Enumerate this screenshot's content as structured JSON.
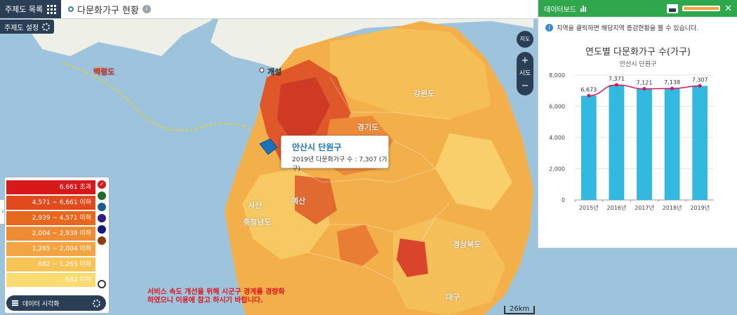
{
  "topbar": {
    "theme_list_label": "주제도 목록",
    "map_title": "다문화가구 현황",
    "info_icon": "info-icon"
  },
  "setting_label": "주제도 설정",
  "zoom": {
    "pin_label": "지도",
    "plus": "+",
    "minus": "−",
    "level_label": "시도"
  },
  "tooltip": {
    "region": "안산시 단원구",
    "detail": "2019년 다문화가구 수 : 7,307 (가구)"
  },
  "places": [
    "백령도",
    "개성",
    "강원도",
    "경기도",
    "충청남도",
    "경상북도",
    "서산",
    "예산",
    "대구"
  ],
  "notice": [
    "서비스 속도 개선을 위해 시군구 경계를 경량화",
    "하였으니 이용에 참고 하시기 바랍니다."
  ],
  "scale_label": "26km",
  "legend": {
    "items": [
      {
        "label": "6,661 초과",
        "color": "#d7191c"
      },
      {
        "label": "4,571 ~ 6,661 이하",
        "color": "#e04a1c"
      },
      {
        "label": "2,939 ~ 4,571 이하",
        "color": "#e8671f"
      },
      {
        "label": "2,004 ~ 2,939 이하",
        "color": "#ee8c33"
      },
      {
        "label": "1,265 ~ 2,004 이하",
        "color": "#f3a544"
      },
      {
        "label": "682 ~ 1,265 이하",
        "color": "#f6c457"
      },
      {
        "label": "682 이하",
        "color": "#f9db70"
      }
    ],
    "swatches": [
      "#d7191c",
      "#1e6b26",
      "#1c5d8c",
      "#2b1d85",
      "#141b7a",
      "#8c3b12"
    ],
    "viz_label": "데이터 시각화"
  },
  "dashboard": {
    "header_label": "데이터보드",
    "info_text": "지역을 클릭하면 해당지역 증감현황을 볼 수 있습니다.",
    "accent": "#2fa74d"
  },
  "chart_data": {
    "type": "bar",
    "title": "연도별 다문화가구 수(가구)",
    "subtitle": "안산시 단원구",
    "categories": [
      "2015년",
      "2016년",
      "2017년",
      "2018년",
      "2019년"
    ],
    "values": [
      6673,
      7371,
      7121,
      7138,
      7307
    ],
    "value_labels": [
      "6,673",
      "7,371",
      "7,121",
      "7,138",
      "7,307"
    ],
    "yticks": [
      "0",
      "2,000",
      "4,000",
      "6,000",
      "8,000"
    ],
    "ylim": [
      0,
      8000
    ],
    "bar_color": "#33b8e0",
    "line_color": "#d1185a",
    "grid": true
  }
}
